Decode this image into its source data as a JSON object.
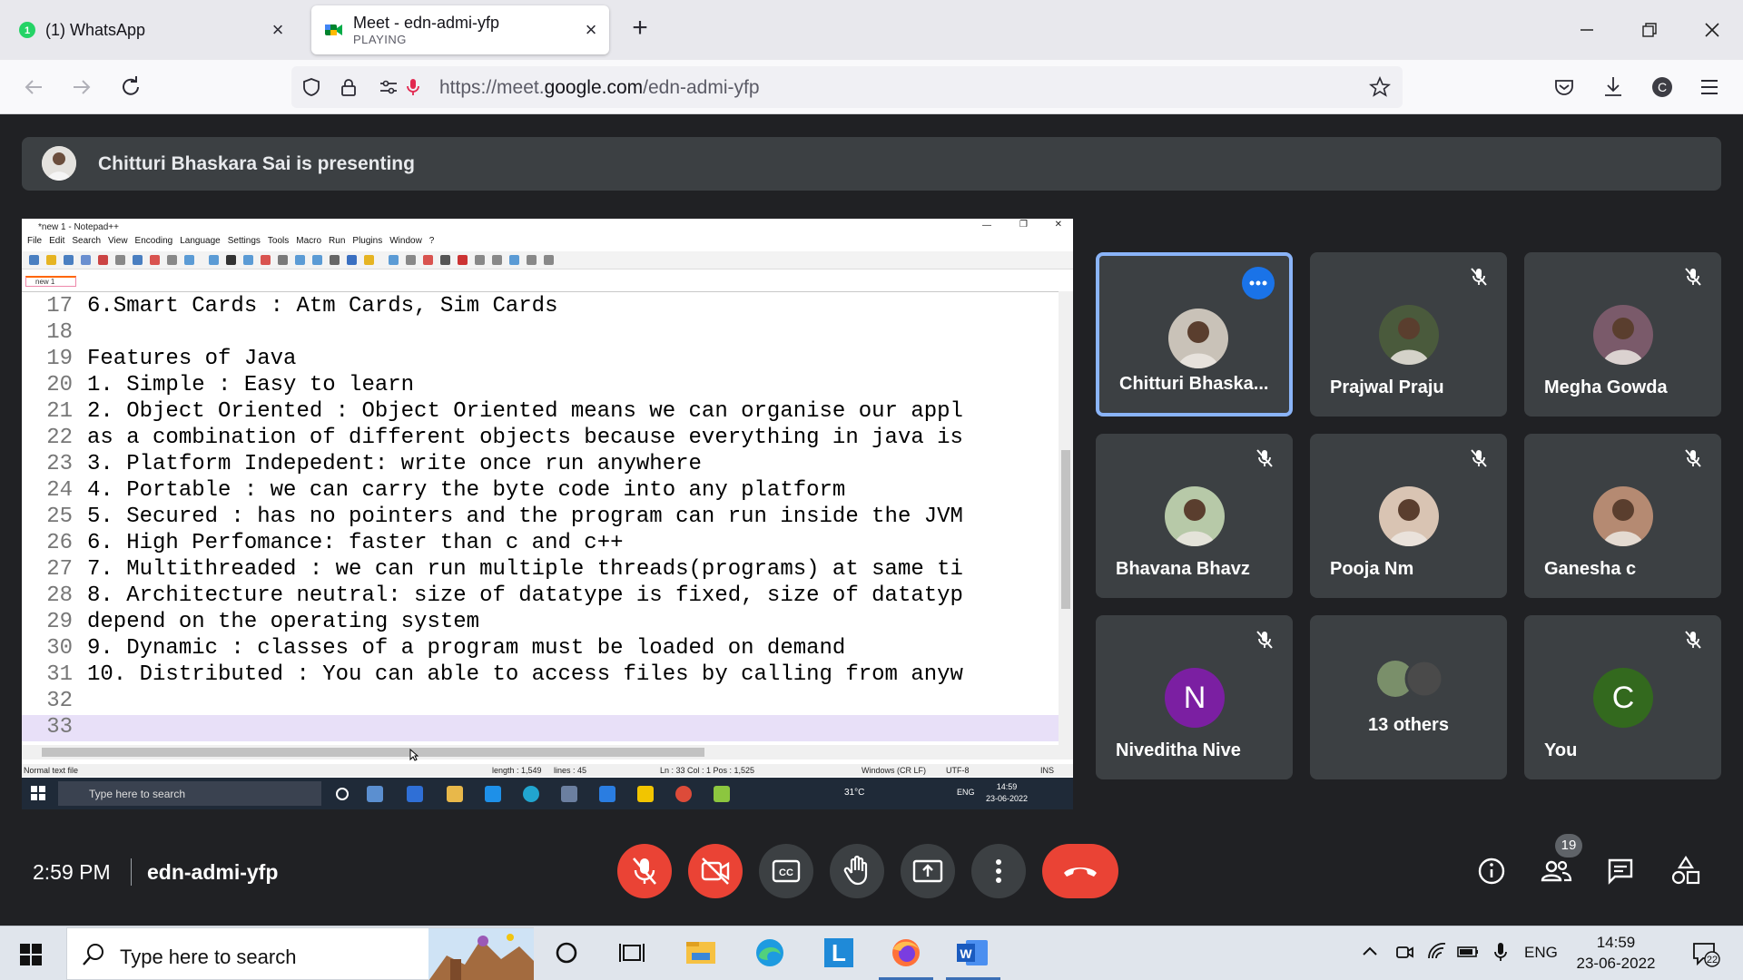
{
  "browser": {
    "tabs": [
      {
        "title": "(1) WhatsApp",
        "badge": "1"
      },
      {
        "title": "Meet - edn-admi-yfp",
        "subtitle": "PLAYING"
      }
    ],
    "url": {
      "prefix": "https://meet.",
      "domain": "google.com",
      "path": "/edn-admi-yfp"
    },
    "profile_initial": "C"
  },
  "meet": {
    "presenting_text": "Chitturi Bhaskara Sai is presenting",
    "time": "2:59 PM",
    "meeting_code": "edn-admi-yfp",
    "participant_count": "19",
    "participants": [
      {
        "name": "Chitturi Bhaska...",
        "active": true,
        "muted": false,
        "avatar_color": "#c9c2b8"
      },
      {
        "name": "Prajwal Praju",
        "muted": true,
        "avatar_color": "#4a5a3c"
      },
      {
        "name": "Megha Gowda",
        "muted": true,
        "avatar_color": "#7a5a6a"
      },
      {
        "name": "Bhavana Bhavz",
        "muted": true,
        "avatar_color": "#b7c9a8"
      },
      {
        "name": "Pooja Nm",
        "muted": true,
        "avatar_color": "#d9c4b3"
      },
      {
        "name": "Ganesha c",
        "muted": true,
        "avatar_color": "#b58a72"
      },
      {
        "name": "Niveditha Nive",
        "letter": "N",
        "muted": true,
        "avatar_color": "#7b1fa2"
      },
      {
        "name": "13 others"
      },
      {
        "name": "You",
        "letter": "C",
        "muted": true,
        "avatar_color": "#33691e"
      }
    ]
  },
  "notepad": {
    "title": "*new 1 - Notepad++",
    "menu": [
      "File",
      "Edit",
      "Search",
      "View",
      "Encoding",
      "Language",
      "Settings",
      "Tools",
      "Macro",
      "Run",
      "Plugins",
      "Window",
      "?"
    ],
    "tab": "new 1",
    "lines": [
      {
        "n": "17",
        "text": "6.Smart Cards : Atm Cards, Sim Cards"
      },
      {
        "n": "18",
        "text": ""
      },
      {
        "n": "19",
        "text": "Features of Java"
      },
      {
        "n": "20",
        "text": "1. Simple : Easy to learn"
      },
      {
        "n": "21",
        "text": "2. Object Oriented : Object Oriented means we can organise our appl"
      },
      {
        "n": "22",
        "text": "as a combination of different objects because everything in java is"
      },
      {
        "n": "23",
        "text": "3. Platform Indepedent: write once run anywhere"
      },
      {
        "n": "24",
        "text": "4. Portable : we can carry the byte code into any platform"
      },
      {
        "n": "25",
        "text": "5. Secured : has no pointers and the program can run inside the JVM"
      },
      {
        "n": "26",
        "text": "6. High Perfomance: faster than c and c++"
      },
      {
        "n": "27",
        "text": "7. Multithreaded : we can run multiple threads(programs) at same ti"
      },
      {
        "n": "28",
        "text": "8. Architecture neutral: size of datatype is fixed, size of datatyp"
      },
      {
        "n": "29",
        "text": "depend on the operating system"
      },
      {
        "n": "30",
        "text": "9. Dynamic : classes of a program must be loaded on demand"
      },
      {
        "n": "31",
        "text": "10. Distributed : You can able to access files by calling from anyw"
      },
      {
        "n": "32",
        "text": ""
      },
      {
        "n": "33",
        "text": ""
      }
    ],
    "status": {
      "type": "Normal text file",
      "length": "length : 1,549",
      "lines": "lines : 45",
      "position": "Ln : 33    Col : 1    Pos : 1,525",
      "eol": "Windows (CR LF)",
      "encoding": "UTF-8",
      "mode": "INS"
    },
    "inner_taskbar": {
      "search": "Type here to search",
      "temp": "31°C",
      "lang": "ENG",
      "time": "14:59",
      "date": "23-06-2022"
    }
  },
  "taskbar": {
    "search_placeholder": "Type here to search",
    "lang": "ENG",
    "time": "14:59",
    "date": "23-06-2022",
    "notifications": "22"
  }
}
